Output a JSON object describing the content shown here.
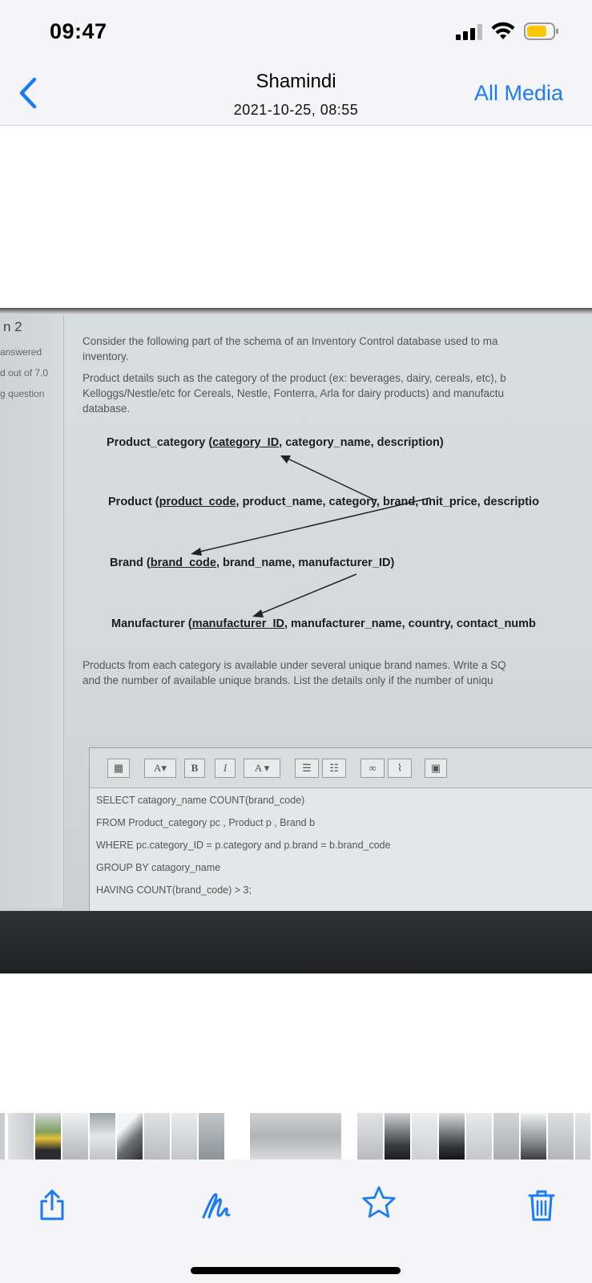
{
  "status_bar": {
    "time": "09:47",
    "signal_icon": "cellular-signal-icon",
    "wifi_icon": "wifi-icon",
    "battery_icon": "battery-icon",
    "battery_color": "#ffc60a"
  },
  "nav": {
    "back_icon": "chevron-left-icon",
    "title": "Shamindi",
    "subtitle": "2021-10-25, 08:55",
    "all_media_label": "All Media",
    "accent_color": "#1a7cf5"
  },
  "photo": {
    "sidebar": {
      "question_number": "n 2",
      "status": "answered",
      "marks": "d out of 7.0",
      "flag": "g question"
    },
    "intro_lines": [
      "Consider the following part of the schema of an Inventory Control database used to ma",
      "inventory."
    ],
    "details_lines": [
      "Product details such as the category of the product (ex: beverages, dairy, cereals, etc), b",
      "Kelloggs/Nestle/etc for Cereals, Nestle, Fonterra, Arla for dairy products) and manufactu",
      "database."
    ],
    "schema": {
      "product_category": {
        "name": "Product_category (",
        "key": "category_ID",
        "rest": ", category_name, description)"
      },
      "product": {
        "name": "Product (",
        "key": "product_code",
        "rest": ", product_name, category, brand, unit_price, descriptio"
      },
      "brand": {
        "name": "Brand (",
        "key": "brand_code",
        "rest": ", brand_name, manufacturer_ID)"
      },
      "manufacturer": {
        "name": "Manufacturer (",
        "key": "manufacturer_ID",
        "rest": ", manufacturer_name, country, contact_numb"
      }
    },
    "question_lines": [
      "Products from each category is available under several unique brand names. Write a SQ",
      "and the number of available unique brands. List the details only if the number of uniqu"
    ],
    "editor_toolbar": [
      "A",
      "B",
      "I",
      "A",
      "link-icon",
      "unlink-icon",
      "image-icon"
    ],
    "code_lines": [
      "SELECT catagory_name COUNT(brand_code)",
      "FROM Product_category pc , Product p , Brand b",
      "WHERE pc.category_ID = p.category and p.brand = b.brand_code",
      "GROUP BY catagory_name",
      "HAVING COUNT(brand_code) > 3;"
    ]
  },
  "toolbar": {
    "share_icon": "share-icon",
    "markup_icon": "markup-icon",
    "favorite_icon": "star-icon",
    "delete_icon": "trash-icon"
  }
}
